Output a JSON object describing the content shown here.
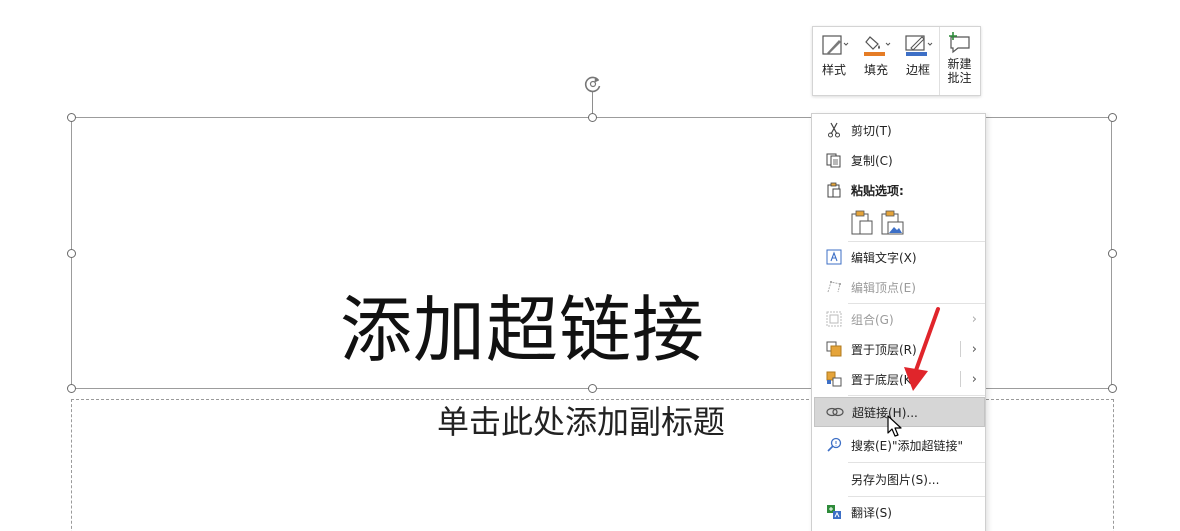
{
  "slide": {
    "title": "添加超链接",
    "subtitle_placeholder": "单击此处添加副标题"
  },
  "mini_toolbar": {
    "items": [
      {
        "label": "样式",
        "icon": "shape-style-icon"
      },
      {
        "label": "填充",
        "icon": "fill-bucket-icon"
      },
      {
        "label": "边框",
        "icon": "pen-outline-icon"
      },
      {
        "label_line1": "新建",
        "label_line2": "批注",
        "icon": "new-comment-icon"
      }
    ]
  },
  "context_menu": {
    "items": [
      {
        "label": "剪切(T)",
        "icon": "scissors-icon",
        "state": "enabled"
      },
      {
        "label": "复制(C)",
        "icon": "copy-icon",
        "state": "enabled"
      },
      {
        "label": "粘贴选项:",
        "icon": "paste-icon",
        "state": "enabled"
      },
      {
        "label": "编辑文字(X)",
        "icon": "edit-text-icon",
        "state": "enabled"
      },
      {
        "label": "编辑顶点(E)",
        "icon": "edit-points-icon",
        "state": "disabled"
      },
      {
        "label": "组合(G)",
        "icon": "group-icon",
        "state": "disabled"
      },
      {
        "label": "置于顶层(R)",
        "icon": "bring-to-front-icon",
        "state": "enabled"
      },
      {
        "label": "置于底层(K)",
        "icon": "send-to-back-icon",
        "state": "enabled"
      },
      {
        "label": "超链接(H)...",
        "icon": "hyperlink-icon",
        "state": "highlighted"
      },
      {
        "label": "搜索(E)\"添加超链接\"",
        "icon": "search-icon",
        "state": "enabled"
      },
      {
        "label": "另存为图片(S)...",
        "icon": "",
        "state": "enabled"
      },
      {
        "label": "翻译(S)",
        "icon": "translate-icon",
        "state": "enabled"
      }
    ],
    "submenu_arrow": "›"
  },
  "colors": {
    "accent_red": "#e0252b",
    "fill_orange": "#e57c25",
    "border_blue": "#3d6fc6",
    "highlight": "#d6d6d6"
  }
}
